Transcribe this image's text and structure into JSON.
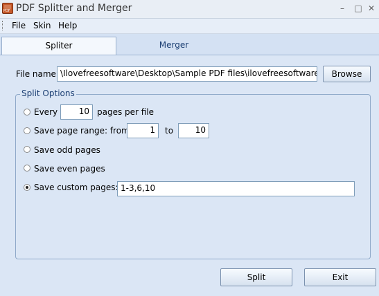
{
  "window": {
    "title": "PDF Splitter and Merger",
    "controls": {
      "minimize": "–",
      "maximize": "□",
      "close": "✕"
    }
  },
  "menu": [
    "File",
    "Skin",
    "Help"
  ],
  "tabs": [
    "Spliter",
    "Merger"
  ],
  "file": {
    "label": "File name:",
    "value": "\\Ilovefreesoftware\\Desktop\\Sample PDF files\\ilovefreesoftware.pdf\"",
    "browse_label": "Browse"
  },
  "split_options": {
    "title": "Split Options",
    "every": {
      "label": "Every",
      "value": "10",
      "suffix": "pages per file"
    },
    "range": {
      "label": "Save page range: from",
      "from": "1",
      "to_label": "to",
      "to": "10"
    },
    "odd": "Save odd pages",
    "even": "Save even pages",
    "custom": {
      "label": "Save custom pages:",
      "value": "1-3,6,10"
    },
    "selected": "custom"
  },
  "buttons": {
    "split": "Split",
    "exit": "Exit"
  }
}
